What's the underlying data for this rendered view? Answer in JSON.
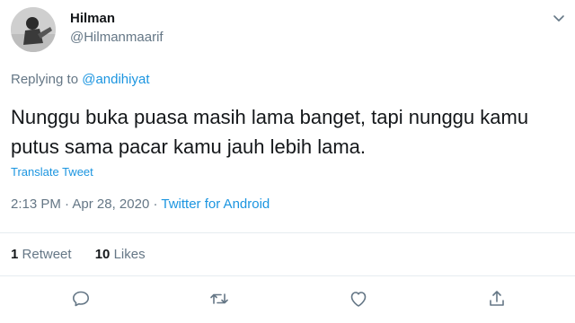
{
  "author": {
    "name": "Hilman",
    "handle": "@Hilmanmaarif"
  },
  "reply": {
    "prefix": "Replying to",
    "to": "@andihiyat"
  },
  "tweet": {
    "text": "Nunggu buka puasa masih lama banget, tapi nunggu kamu putus sama pacar kamu jauh lebih lama."
  },
  "translate_label": "Translate Tweet",
  "meta": {
    "time": "2:13 PM",
    "date": "Apr 28, 2020",
    "source": "Twitter for Android",
    "separator": "·"
  },
  "stats": {
    "retweets_count": "1",
    "retweets_label": "Retweet",
    "likes_count": "10",
    "likes_label": "Likes"
  },
  "icons": {
    "caret": "chevron-down-icon",
    "reply": "reply-icon",
    "retweet": "retweet-icon",
    "like": "heart-icon",
    "share": "share-icon"
  },
  "colors": {
    "link": "#1b95e0",
    "muted": "#657786",
    "text": "#14171a",
    "divider": "#e6ecf0"
  }
}
